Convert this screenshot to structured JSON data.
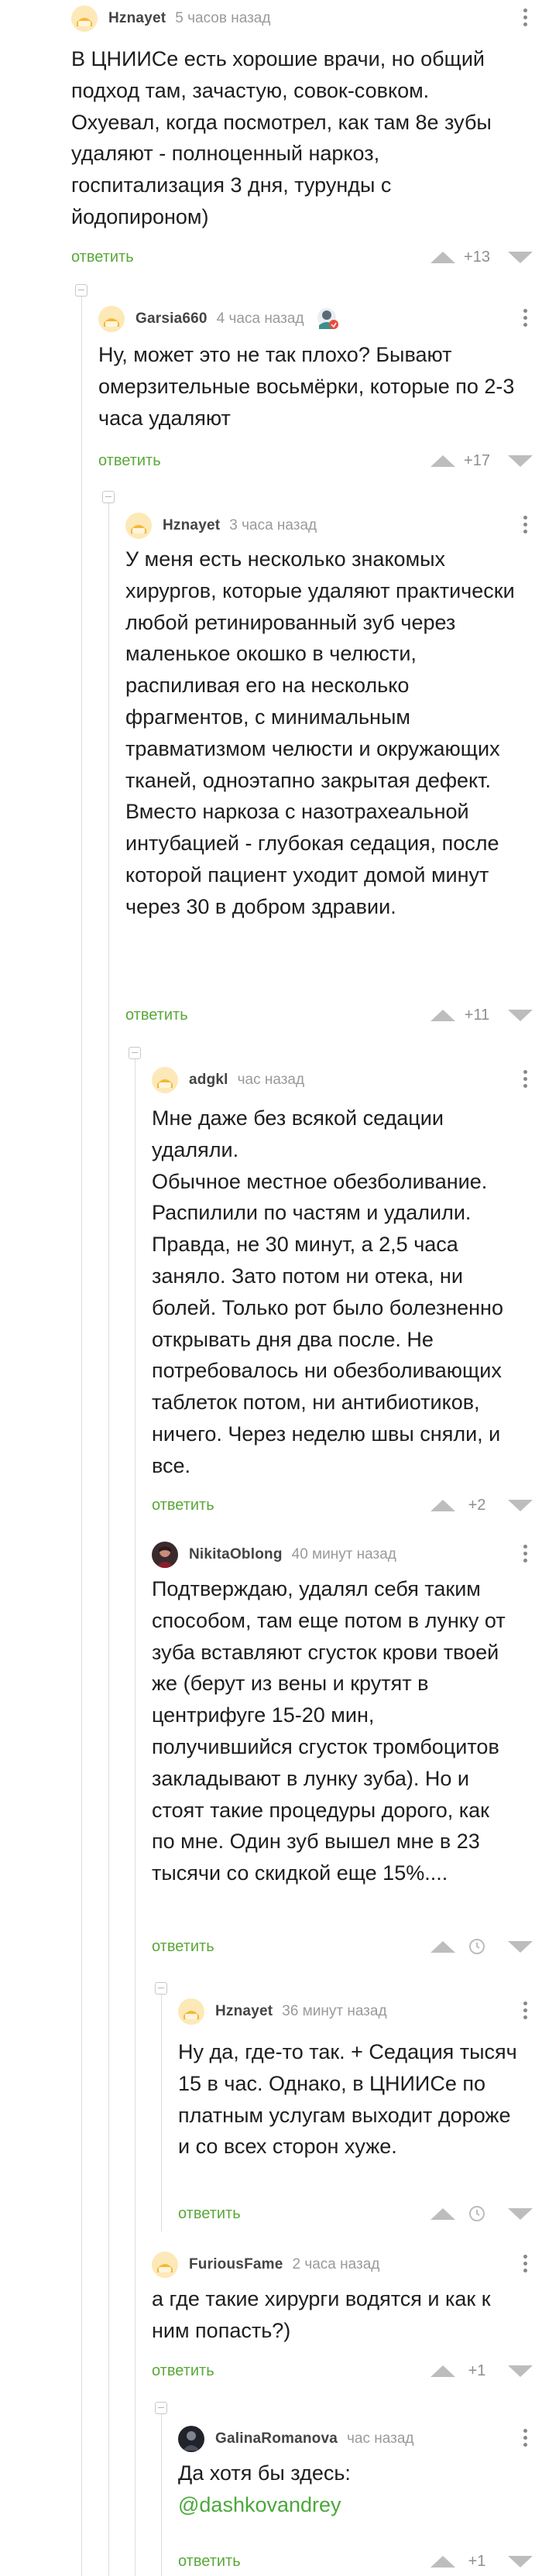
{
  "comments": [
    {
      "nick": "Hznayet",
      "time": "5 часов назад",
      "text": "В ЦНИИСе есть хорошие врачи, но общий подход там, зачастую, совок-совком. Охуевал, когда посмотрел, как там 8е зубы удаляют - полноценный наркоз, госпитализация 3 дня, турунды с йодопироном)",
      "reply_label": "ответить",
      "score": "+13"
    },
    {
      "nick": "Garsia660",
      "time": "4 часа назад",
      "text": "Ну, может это не так плохо? Бывают омерзительные восьмёрки, которые по 2-3 часа удаляют",
      "reply_label": "ответить",
      "score": "+17"
    },
    {
      "nick": "Hznayet",
      "time": "3 часа назад",
      "text": "У меня есть несколько знакомых хирургов, которые удаляют практически любой ретинированный зуб через маленькое окошко в челюсти, распиливая его на несколько фрагментов, с минимальным травматизмом челюсти и окружающих тканей, одноэтапно закрытая дефект. Вместо наркоза с назотрахеальной интубацией - глубокая седация, после которой пациент уходит домой минут через 30 в добром здравии.",
      "reply_label": "ответить",
      "score": "+11"
    },
    {
      "nick": "adgkl",
      "time": "час назад",
      "text": "Мне даже без всякой седации удаляли.",
      "text2": "Обычное местное обезболивание. Распилили по частям и удалили. Правда, не 30 минут, а 2,5 часа заняло. Зато потом ни отека, ни болей. Только рот было болезненно открывать дня два после. Не потребовалось ни обезболивающих таблеток потом, ни антибиотиков, ничего. Через неделю швы сняли, и все.",
      "reply_label": "ответить",
      "score": "+2"
    },
    {
      "nick": "NikitaOblong",
      "time": "40 минут назад",
      "text": "Подтверждаю, удалял себя таким способом, там еще потом в лунку от зуба вставляют сгусток крови твоей же (берут из вены и крутят в центрифуге 15-20 мин, получившийся сгусток тромбоцитов закладывают в лунку зуба). Но и стоят такие процедуры дорого, как по мне. Один зуб вышел мне в 23 тысячи со скидкой еще 15%....",
      "reply_label": "ответить"
    },
    {
      "nick": "Hznayet",
      "time": "36 минут назад",
      "text": "Ну да, где-то так. + Седация тысяч 15 в час. Однако, в ЦНИИСе по платным услугам выходит дороже и со всех сторон хуже.",
      "reply_label": "ответить"
    },
    {
      "nick": "FuriousFame",
      "time": "2 часа назад",
      "text": "а где такие хирурги водятся и как к ним попасть?)",
      "reply_label": "ответить",
      "score": "+1"
    },
    {
      "nick": "GalinaRomanova",
      "time": "час назад",
      "text": "Да хотя бы здесь:",
      "mention": "@dashkovandrey",
      "reply_label": "ответить",
      "score": "+1"
    }
  ],
  "colors": {
    "accent_green": "#59a839",
    "muted_gray": "#9a9a9a",
    "vote_arrow": "#bdbdbd"
  },
  "icons": [
    "more-vertical-icon",
    "vote-up-icon",
    "vote-down-icon",
    "clock-icon",
    "award-badge-icon",
    "collapse-thread-icon"
  ]
}
